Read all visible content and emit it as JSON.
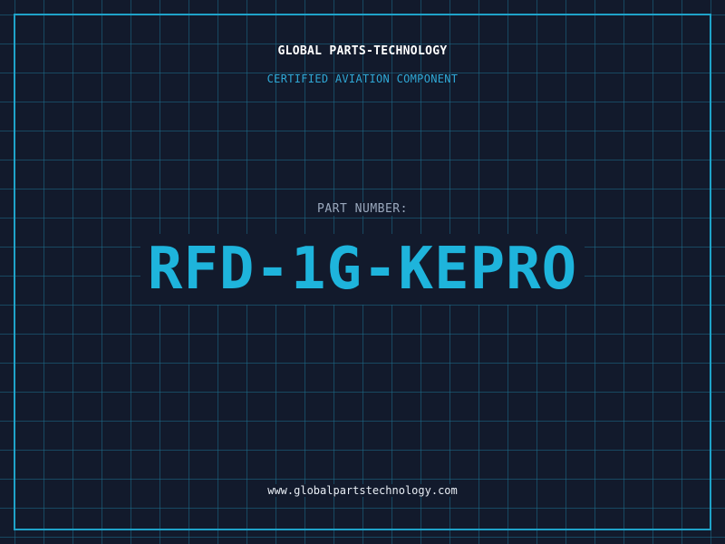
{
  "header": {
    "company": "GLOBAL PARTS-TECHNOLOGY",
    "tagline": "CERTIFIED AVIATION COMPONENT"
  },
  "part": {
    "label": "PART NUMBER:",
    "number": "RFD-1G-KEPRO"
  },
  "footer": {
    "website": "www.globalpartstechnology.com"
  },
  "colors": {
    "background": "#121a2c",
    "grid": "#1e6e8c",
    "accent": "#1fa3c9",
    "part_number": "#1eb4dc"
  }
}
